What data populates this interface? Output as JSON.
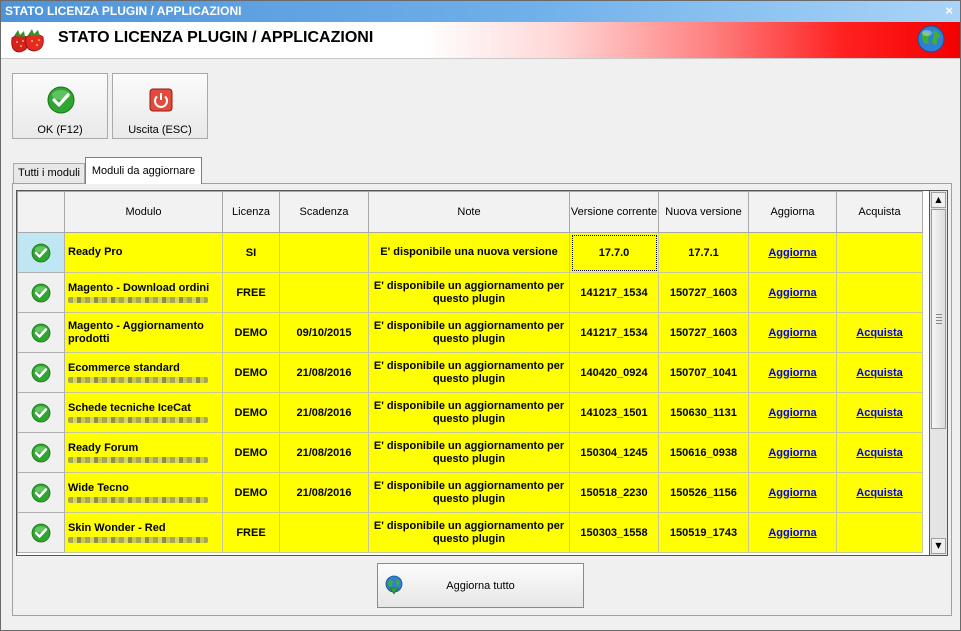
{
  "window": {
    "title": "STATO LICENZA PLUGIN / APPLICAZIONI",
    "banner_title": "STATO LICENZA PLUGIN / APPLICAZIONI",
    "close_glyph": "×"
  },
  "toolbar": {
    "ok_label": "OK (F12)",
    "exit_label": "Uscita (ESC)"
  },
  "tabs": [
    {
      "label": "Tutti i moduli",
      "active": false
    },
    {
      "label": "Moduli da aggiornare",
      "active": true
    }
  ],
  "table": {
    "columns": [
      "Modulo",
      "Licenza",
      "Scadenza",
      "Note",
      "Versione corrente",
      "Nuova versione",
      "Aggiorna",
      "Acquista"
    ],
    "rows": [
      {
        "modulo": "Ready Pro",
        "licenza": "SI",
        "scadenza": "",
        "note": "E' disponibile una nuova versione",
        "versione_corrente": "17.7.0",
        "nuova_versione": "17.7.1",
        "aggiorna": "Aggiorna",
        "acquista": ""
      },
      {
        "modulo": "Magento - Download ordini",
        "licenza": "FREE",
        "scadenza": "",
        "note": "E' disponibile un aggiornamento per questo plugin",
        "versione_corrente": "141217_1534",
        "nuova_versione": "150727_1603",
        "aggiorna": "Aggiorna",
        "acquista": ""
      },
      {
        "modulo": "Magento - Aggiornamento prodotti",
        "licenza": "DEMO",
        "scadenza": "09/10/2015",
        "note": "E' disponibile un aggiornamento per questo plugin",
        "versione_corrente": "141217_1534",
        "nuova_versione": "150727_1603",
        "aggiorna": "Aggiorna",
        "acquista": "Acquista"
      },
      {
        "modulo": "Ecommerce standard",
        "licenza": "DEMO",
        "scadenza": "21/08/2016",
        "note": "E' disponibile un aggiornamento per questo plugin",
        "versione_corrente": "140420_0924",
        "nuova_versione": "150707_1041",
        "aggiorna": "Aggiorna",
        "acquista": "Acquista"
      },
      {
        "modulo": "Schede tecniche IceCat",
        "licenza": "DEMO",
        "scadenza": "21/08/2016",
        "note": "E' disponibile un aggiornamento per questo plugin",
        "versione_corrente": "141023_1501",
        "nuova_versione": "150630_1131",
        "aggiorna": "Aggiorna",
        "acquista": "Acquista"
      },
      {
        "modulo": "Ready Forum",
        "licenza": "DEMO",
        "scadenza": "21/08/2016",
        "note": "E' disponibile un aggiornamento per questo plugin",
        "versione_corrente": "150304_1245",
        "nuova_versione": "150616_0938",
        "aggiorna": "Aggiorna",
        "acquista": "Acquista"
      },
      {
        "modulo": "Wide Tecno",
        "licenza": "DEMO",
        "scadenza": "21/08/2016",
        "note": "E' disponibile un aggiornamento per questo plugin",
        "versione_corrente": "150518_2230",
        "nuova_versione": "150526_1156",
        "aggiorna": "Aggiorna",
        "acquista": "Acquista"
      },
      {
        "modulo": "Skin Wonder - Red",
        "licenza": "FREE",
        "scadenza": "",
        "note": "E' disponibile un aggiornamento per questo plugin",
        "versione_corrente": "150303_1558",
        "nuova_versione": "150519_1743",
        "aggiorna": "Aggiorna",
        "acquista": ""
      }
    ]
  },
  "footer": {
    "update_all_label": "Aggiorna tutto"
  },
  "icons": {
    "check": "check-circle-icon",
    "power": "power-icon",
    "globe": "globe-icon",
    "logo": "strawberry-logo-icon",
    "update": "globe-download-icon"
  },
  "colors": {
    "row_highlight": "#ffff00",
    "link": "#0000ee",
    "banner_red": "#f40000"
  }
}
